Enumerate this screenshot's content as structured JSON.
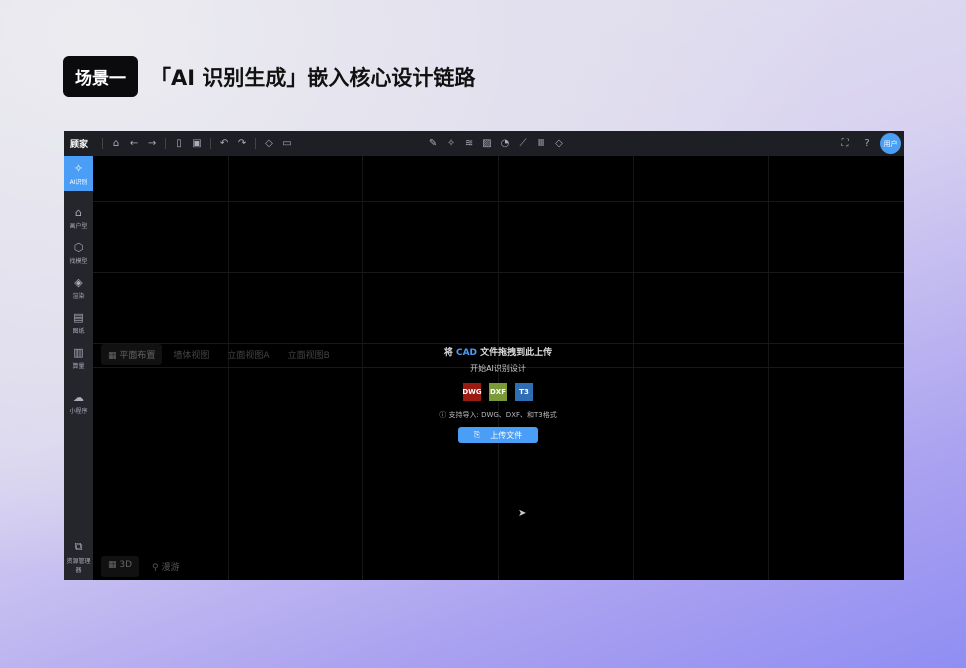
{
  "header": {
    "badge": "场景一",
    "title": "「AI 识别生成」嵌入核心设计链路"
  },
  "toolbar": {
    "logo": "顾家",
    "avatar": "用户"
  },
  "sidebar": {
    "items": [
      {
        "label": "AI识别",
        "glyph": "✧"
      },
      {
        "label": "画户型",
        "glyph": "⌂"
      },
      {
        "label": "找模型",
        "glyph": "⬡"
      },
      {
        "label": "渲染",
        "glyph": "◈"
      },
      {
        "label": "图纸",
        "glyph": "▤"
      },
      {
        "label": "算量",
        "glyph": "▥"
      },
      {
        "label": "小程序",
        "glyph": "☁"
      }
    ],
    "bottom": {
      "label": "资源管理器",
      "glyph": "⧉"
    }
  },
  "view_tabs": [
    "平面布置",
    "墙体视图",
    "立面视图A",
    "立面视图B"
  ],
  "bottom_tabs": {
    "d3": "3D",
    "tour": "漫游"
  },
  "upload": {
    "title_pre": "将 ",
    "title_cad": "CAD",
    "title_post": " 文件拖拽到此上传",
    "subtitle": "开始AI识别设计",
    "formats": [
      {
        "label": "DWG",
        "color": "#9b1a12"
      },
      {
        "label": "DXF",
        "color": "#7a9a3a"
      },
      {
        "label": "T3",
        "color": "#2f6db5"
      }
    ],
    "support": "支持导入: DWG、DXF、和T3格式",
    "button": "上传文件"
  }
}
